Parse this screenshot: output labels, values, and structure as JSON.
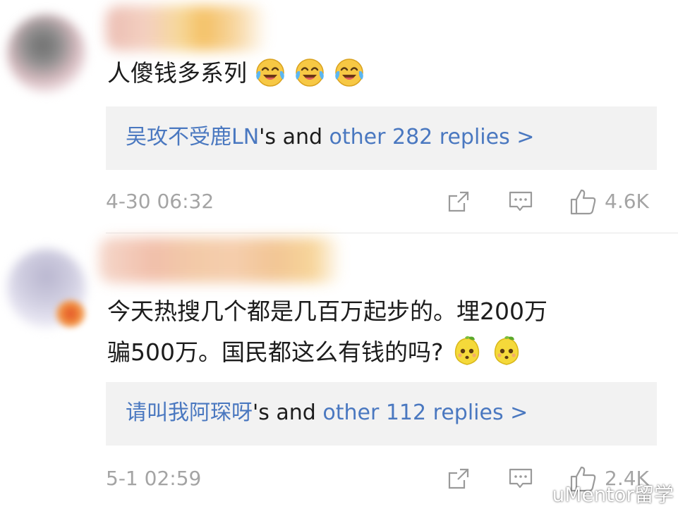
{
  "comments": [
    {
      "text": "人傻钱多系列",
      "emojis": [
        "laugh-cry-emoji",
        "laugh-cry-emoji",
        "laugh-cry-emoji"
      ],
      "replies": {
        "user": "吴攻不受鹿LN",
        "mid": "'s and ",
        "link": "other 282 replies >"
      },
      "timestamp": "4-30 06:32",
      "likes": "4.6K"
    },
    {
      "text_line1": "今天热搜几个都是几百万起步的。埋200万",
      "text_line2": "骗500万。国民都这么有钱的吗?",
      "emojis": [
        "lemon-sour-emoji",
        "lemon-sour-emoji"
      ],
      "replies": {
        "user": "请叫我阿琛呀",
        "mid": "'s and ",
        "link": "other 112 replies >"
      },
      "timestamp": "5-1 02:59",
      "likes": "2.4K"
    }
  ],
  "icons": {
    "share": "share-icon",
    "comment": "comment-icon",
    "like": "thumbs-up-icon",
    "watermark": "weibo-logo-icon"
  },
  "colors": {
    "link": "#4a78c0",
    "meta": "#a4a4a4",
    "reply_box": "#f2f2f2",
    "text": "#1c1c1c"
  },
  "watermark": {
    "text": "uMentor留学"
  }
}
